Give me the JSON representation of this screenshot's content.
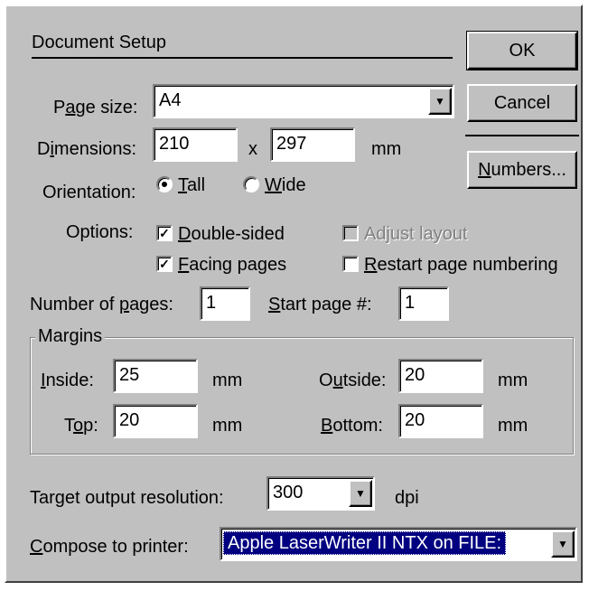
{
  "dialog": {
    "title": "Document Setup",
    "buttons": {
      "ok": "OK",
      "cancel": "Cancel",
      "numbers": "Numbers..."
    },
    "page_size": {
      "label_pre": "P",
      "label_u": "a",
      "label_post": "ge size:",
      "value": "A4"
    },
    "dimensions": {
      "label_pre": "D",
      "label_u": "i",
      "label_post": "mensions:",
      "width": "210",
      "separator": "x",
      "height": "297",
      "unit": "mm"
    },
    "orientation": {
      "label": "Orientation:",
      "tall_u": "T",
      "tall_rest": "all",
      "wide_u": "W",
      "wide_rest": "ide",
      "selected": "Tall"
    },
    "options": {
      "label": "Options:",
      "double_sided_u": "D",
      "double_sided_rest": "ouble-sided",
      "double_sided_checked": true,
      "facing_u": "F",
      "facing_rest": "acing pages",
      "facing_checked": true,
      "adjust_layout": "Adjust layout",
      "adjust_checked": false,
      "adjust_disabled": true,
      "restart_u": "R",
      "restart_rest": "estart page numbering",
      "restart_checked": false
    },
    "pages": {
      "num_label_pre": "Number of ",
      "num_label_u": "p",
      "num_label_post": "ages:",
      "num_value": "1",
      "start_label_u": "S",
      "start_label_post": "tart page #:",
      "start_value": "1"
    },
    "margins": {
      "legend": "Margins",
      "inside_u": "I",
      "inside_rest": "nside:",
      "inside_value": "25",
      "outside_pre": "O",
      "outside_u": "u",
      "outside_post": "tside:",
      "outside_value": "20",
      "top_pre": "T",
      "top_u": "o",
      "top_post": "p:",
      "top_value": "20",
      "bottom_u": "B",
      "bottom_rest": "ottom:",
      "bottom_value": "20",
      "unit": "mm"
    },
    "resolution": {
      "label_pre": "Tar",
      "label_u": "g",
      "label_post": "et output resolution:",
      "value": "300",
      "unit": "dpi"
    },
    "printer": {
      "label_u": "C",
      "label_rest": "ompose to printer:",
      "value": "Apple LaserWriter II NTX on FILE:"
    }
  },
  "colors": {
    "face": "#c0c0c0",
    "selection": "#000080",
    "disabled": "#808080"
  }
}
